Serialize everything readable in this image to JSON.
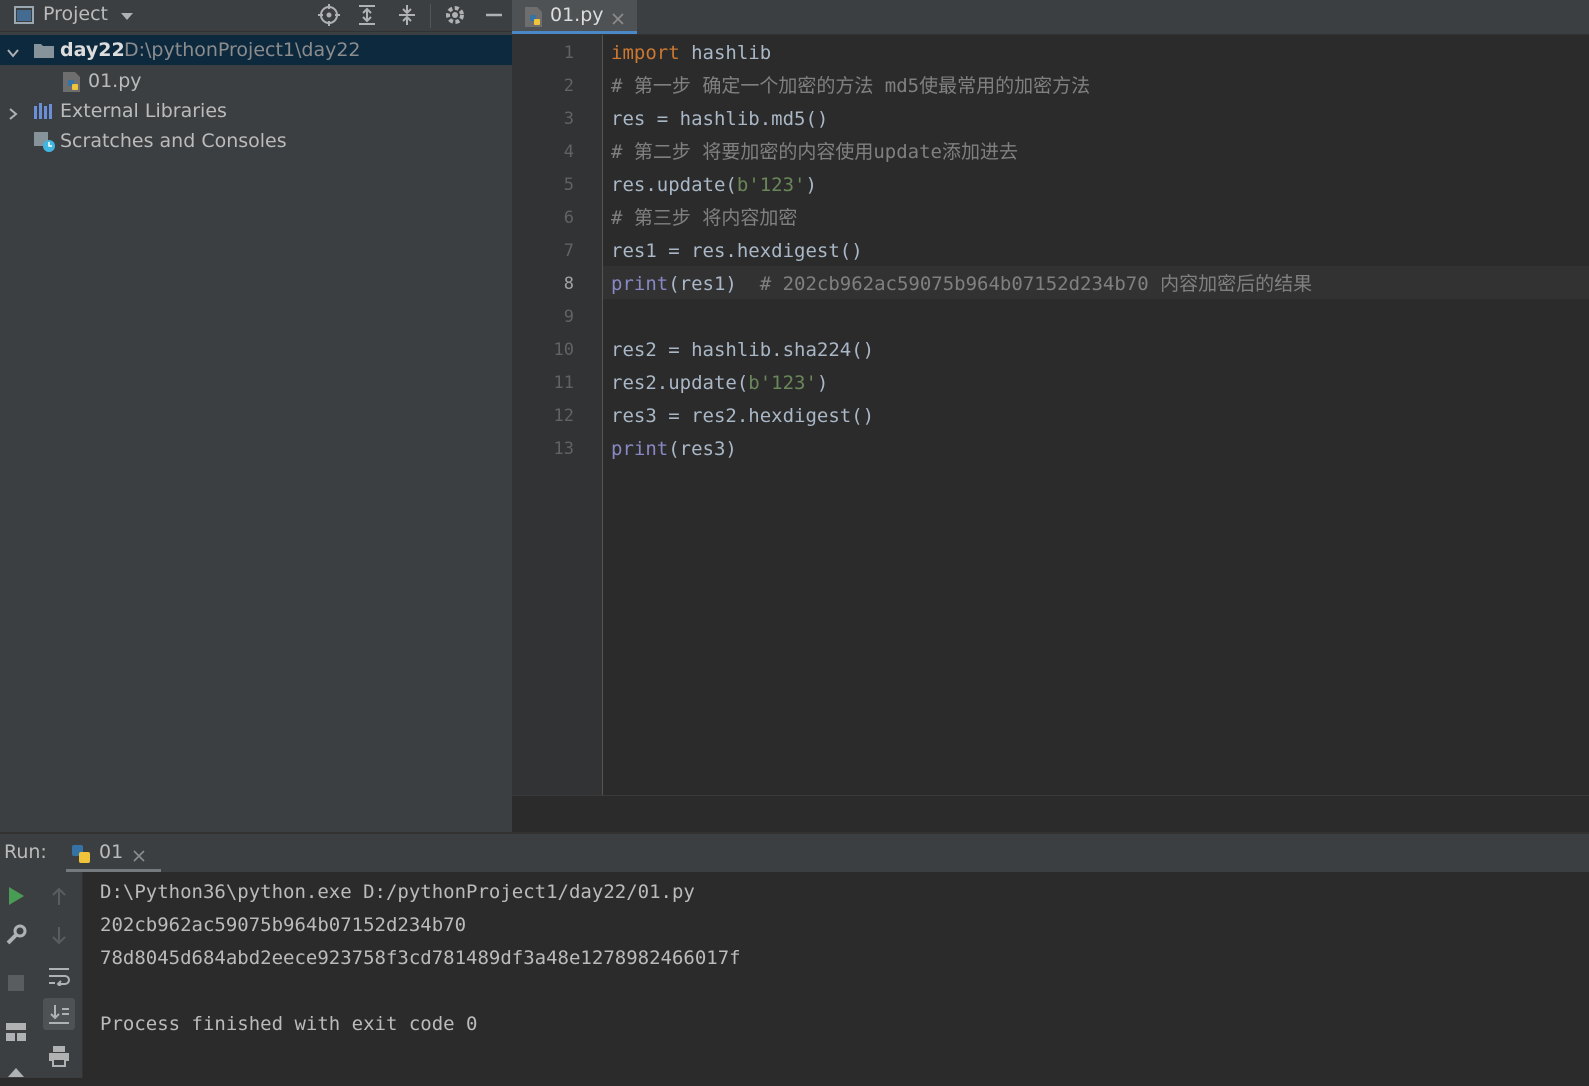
{
  "project_panel": {
    "title": "Project",
    "tree": [
      {
        "label": "day22",
        "path": "D:\\pythonProject1\\day22"
      },
      {
        "label": "01.py"
      },
      {
        "label": "External Libraries"
      },
      {
        "label": "Scratches and Consoles"
      }
    ]
  },
  "editor": {
    "tab_label": "01.py",
    "current_line": 8,
    "lines": [
      {
        "n": "1",
        "tokens": [
          {
            "t": "import",
            "c": "kw"
          },
          {
            "t": " hashlib",
            "c": ""
          }
        ]
      },
      {
        "n": "2",
        "tokens": [
          {
            "t": "# 第一步 确定一个加密的方法 md5使最常用的加密方法",
            "c": "cmt"
          }
        ]
      },
      {
        "n": "3",
        "tokens": [
          {
            "t": "res = hashlib.md5()",
            "c": ""
          }
        ]
      },
      {
        "n": "4",
        "tokens": [
          {
            "t": "# 第二步 将要加密的内容使用update添加进去",
            "c": "cmt"
          }
        ]
      },
      {
        "n": "5",
        "tokens": [
          {
            "t": "res.update(",
            "c": ""
          },
          {
            "t": "b'123'",
            "c": "str"
          },
          {
            "t": ")",
            "c": ""
          }
        ]
      },
      {
        "n": "6",
        "tokens": [
          {
            "t": "# 第三步 将内容加密",
            "c": "cmt"
          }
        ]
      },
      {
        "n": "7",
        "tokens": [
          {
            "t": "res1 = res.hexdigest()",
            "c": ""
          }
        ]
      },
      {
        "n": "8",
        "tokens": [
          {
            "t": "print",
            "c": "bi"
          },
          {
            "t": "(res1)  ",
            "c": ""
          },
          {
            "t": "# 202cb962ac59075b964b07152d234b70 内容加密后的结果",
            "c": "cmt"
          }
        ]
      },
      {
        "n": "9",
        "tokens": []
      },
      {
        "n": "10",
        "tokens": [
          {
            "t": "res2 = hashlib.sha224()",
            "c": ""
          }
        ]
      },
      {
        "n": "11",
        "tokens": [
          {
            "t": "res2.update(",
            "c": ""
          },
          {
            "t": "b'123'",
            "c": "str"
          },
          {
            "t": ")",
            "c": ""
          }
        ]
      },
      {
        "n": "12",
        "tokens": [
          {
            "t": "res3 = res2.hexdigest()",
            "c": ""
          }
        ]
      },
      {
        "n": "13",
        "tokens": [
          {
            "t": "print",
            "c": "bi"
          },
          {
            "t": "(res3)",
            "c": ""
          }
        ]
      }
    ]
  },
  "run": {
    "label": "Run:",
    "tab_label": "01",
    "output": [
      "D:\\Python36\\python.exe D:/pythonProject1/day22/01.py",
      "202cb962ac59075b964b07152d234b70",
      "78d8045d684abd2eece923758f3cd781489df3a48e1278982466017f",
      "",
      "Process finished with exit code 0"
    ]
  },
  "colors": {
    "keyword": "#cc7832",
    "builtin": "#8888c6",
    "string": "#6a8759",
    "comment": "#808080",
    "accent": "#4a88c7"
  }
}
